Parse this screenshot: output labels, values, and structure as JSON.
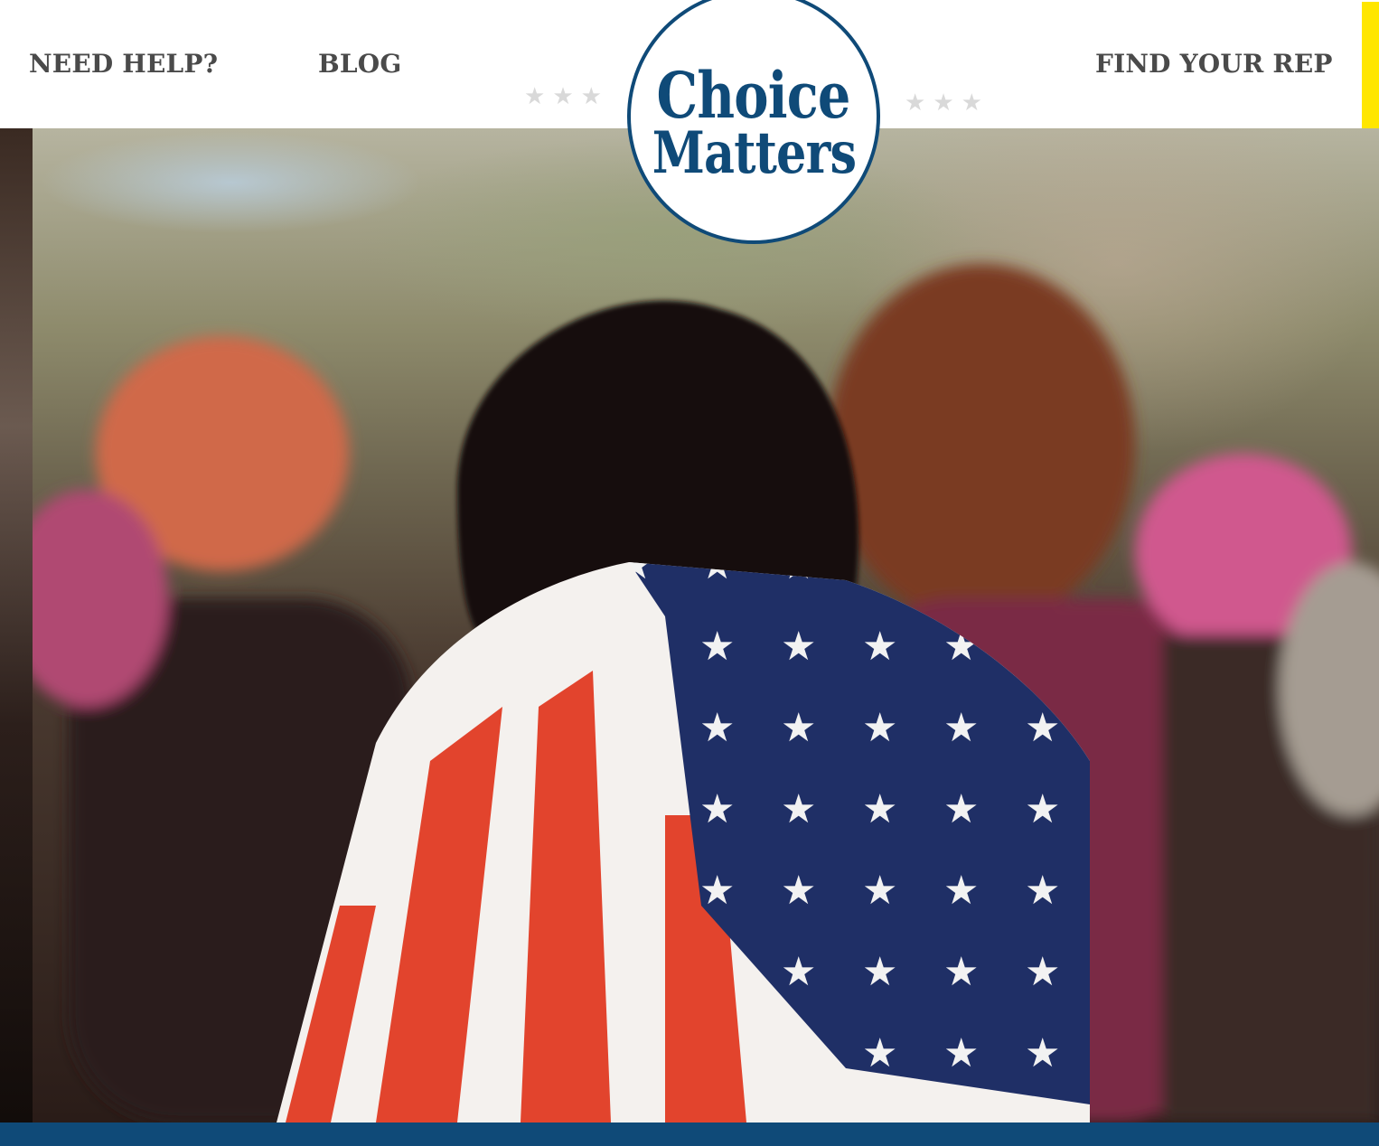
{
  "nav": {
    "need_help": "NEED HELP?",
    "blog": "BLOG",
    "find_rep": "FIND YOUR REP"
  },
  "logo": {
    "line1": "Choice",
    "line2": "Matters"
  },
  "decor": {
    "star_glyph": "★★★"
  },
  "colors": {
    "brand_blue": "#0f4a78",
    "accent_yellow": "#ffe600",
    "nav_text": "#4a4a4a"
  }
}
